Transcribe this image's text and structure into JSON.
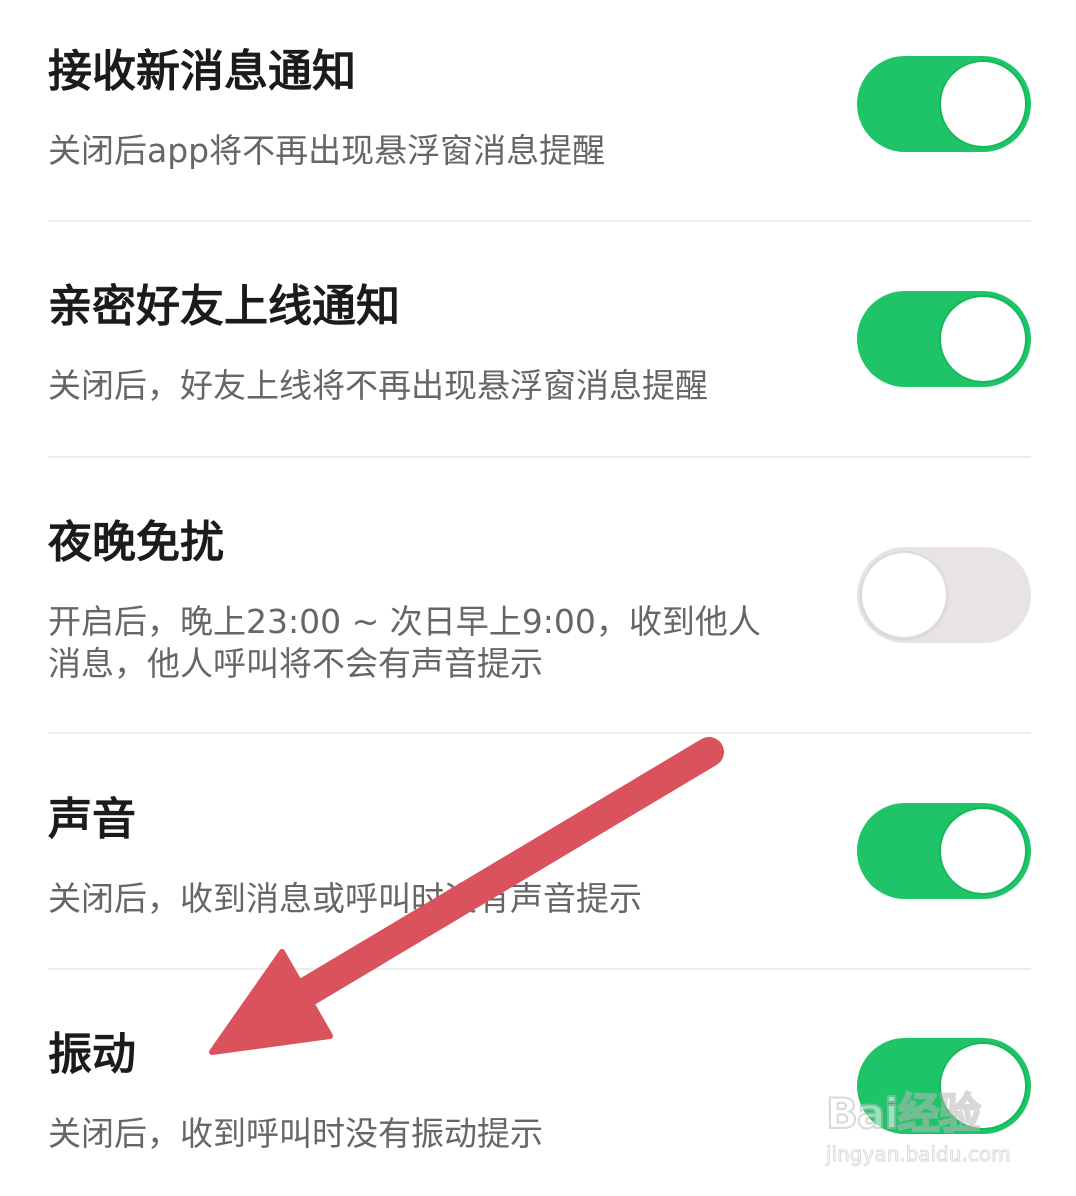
{
  "settings": [
    {
      "title": "接收新消息通知",
      "description": "关闭后app将不再出现悬浮窗消息提醒",
      "enabled": true
    },
    {
      "title": "亲密好友上线通知",
      "description": "关闭后，好友上线将不再出现悬浮窗消息提醒",
      "enabled": true
    },
    {
      "title": "夜晚免扰",
      "description": "开启后，晚上23:00 ~ 次日早上9:00，收到他人消息，他人呼叫将不会有声音提示",
      "enabled": false
    },
    {
      "title": "声音",
      "description": "关闭后，收到消息或呼叫时没有声音提示",
      "enabled": true
    },
    {
      "title": "振动",
      "description": "关闭后，收到呼叫时没有振动提示",
      "enabled": true
    }
  ],
  "annotation": {
    "arrow_color": "#d9525c",
    "arrow_icon": "arrow-pointer-icon"
  },
  "watermark": {
    "logo": "Bai经验",
    "url": "jingyan.baidu.com"
  },
  "colors": {
    "toggle_on": "#20c468",
    "toggle_off": "#e8e4e4"
  }
}
